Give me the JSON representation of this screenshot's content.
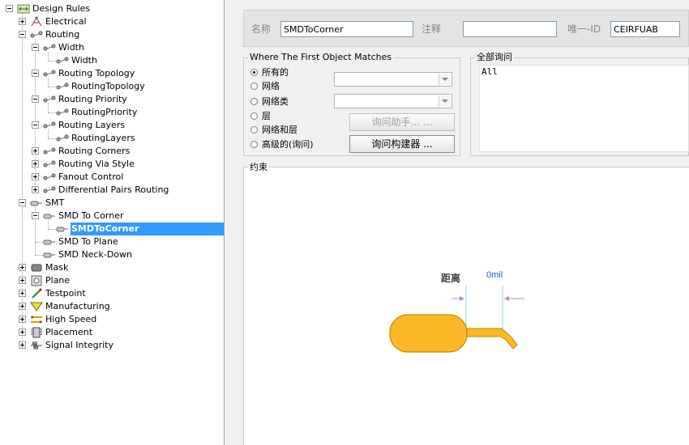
{
  "tree": {
    "items": [
      {
        "label": "Design Rules",
        "icon": "design-rules-icon",
        "expander": "minus"
      },
      {
        "label": "Electrical",
        "icon": "electrical-icon",
        "expander": "plus"
      },
      {
        "label": "Routing",
        "icon": "routing-icon",
        "expander": "minus"
      },
      {
        "label": "Width",
        "icon": "routing-icon",
        "expander": "minus"
      },
      {
        "label": "Width",
        "icon": "routing-icon",
        "expander": "none"
      },
      {
        "label": "Routing Topology",
        "icon": "routing-icon",
        "expander": "minus"
      },
      {
        "label": "RoutingTopology",
        "icon": "routing-icon",
        "expander": "none"
      },
      {
        "label": "Routing Priority",
        "icon": "routing-icon",
        "expander": "minus"
      },
      {
        "label": "RoutingPriority",
        "icon": "routing-icon",
        "expander": "none"
      },
      {
        "label": "Routing Layers",
        "icon": "routing-icon",
        "expander": "minus"
      },
      {
        "label": "RoutingLayers",
        "icon": "routing-icon",
        "expander": "none"
      },
      {
        "label": "Routing Corners",
        "icon": "routing-icon",
        "expander": "plus"
      },
      {
        "label": "Routing Via Style",
        "icon": "routing-icon",
        "expander": "plus"
      },
      {
        "label": "Fanout Control",
        "icon": "routing-icon",
        "expander": "plus"
      },
      {
        "label": "Differential Pairs Routing",
        "icon": "routing-icon",
        "expander": "plus"
      },
      {
        "label": "SMT",
        "icon": "smt-icon",
        "expander": "minus"
      },
      {
        "label": "SMD To Corner",
        "icon": "smt-icon",
        "expander": "minus"
      },
      {
        "label": "SMDToCorner",
        "icon": "smt-icon",
        "expander": "none",
        "selected": true
      },
      {
        "label": "SMD To Plane",
        "icon": "smt-icon",
        "expander": "none"
      },
      {
        "label": "SMD Neck-Down",
        "icon": "smt-icon",
        "expander": "none"
      },
      {
        "label": "Mask",
        "icon": "mask-icon",
        "expander": "plus"
      },
      {
        "label": "Plane",
        "icon": "plane-icon",
        "expander": "plus"
      },
      {
        "label": "Testpoint",
        "icon": "testpoint-icon",
        "expander": "plus"
      },
      {
        "label": "Manufacturing",
        "icon": "manufacturing-icon",
        "expander": "plus"
      },
      {
        "label": "High Speed",
        "icon": "high-speed-icon",
        "expander": "plus"
      },
      {
        "label": "Placement",
        "icon": "placement-icon",
        "expander": "plus"
      },
      {
        "label": "Signal Integrity",
        "icon": "signal-integrity-icon",
        "expander": "plus"
      }
    ]
  },
  "header": {
    "name_label": "名称",
    "name_value": "SMDToCorner",
    "comment_label": "注释",
    "comment_value": "",
    "id_label": "唯一-ID",
    "id_value": "CEIRFUAB"
  },
  "match": {
    "title": "Where The First Object Matches",
    "options": [
      "所有的",
      "网络",
      "网络类",
      "层",
      "网络和层",
      "高级的(询问)"
    ],
    "selected_index": 0,
    "query_helper": "询问助手... ...",
    "query_builder": "询问构建器 ..."
  },
  "full_query": {
    "title": "全部询问",
    "text": "All"
  },
  "constraints": {
    "title": "约束",
    "distance_label": "距离",
    "distance_value": "0mil"
  },
  "colors": {
    "pad": "#fdb827",
    "pad_outline": "#c48a00",
    "dim": "#c080d0",
    "selection": "#3399ff"
  }
}
